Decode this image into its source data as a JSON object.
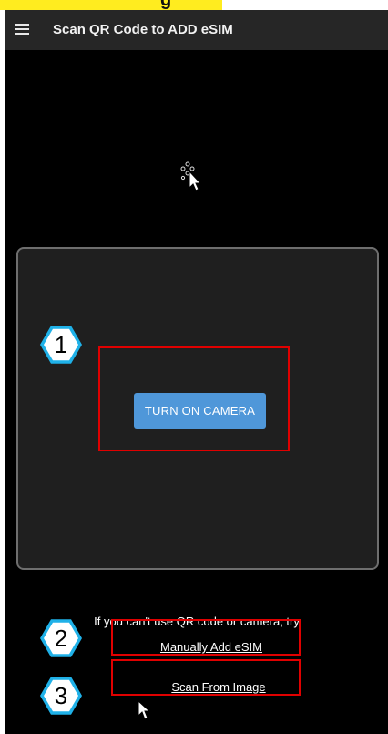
{
  "banner": {
    "partial_text": "g"
  },
  "app_bar": {
    "title": "Scan QR Code to ADD eSIM",
    "menu_icon": "hamburger-menu-icon"
  },
  "camera_panel": {
    "button_label": "TURN ON CAMERA",
    "loading_icon": "loading-dots-icon"
  },
  "alternatives": {
    "hint": "If you can't use QR code or camera, try",
    "manual_link": "Manually Add eSIM",
    "image_link": "Scan From Image"
  },
  "annotations": {
    "steps": [
      "1",
      "2",
      "3"
    ],
    "badge_color": "#1fb1e8",
    "highlight_color": "#e00000",
    "banner_color": "#ffec1f"
  },
  "colors": {
    "app_bar": "#262626",
    "background": "#000000",
    "panel": "#1f1f1f",
    "button": "#4f97d9"
  }
}
